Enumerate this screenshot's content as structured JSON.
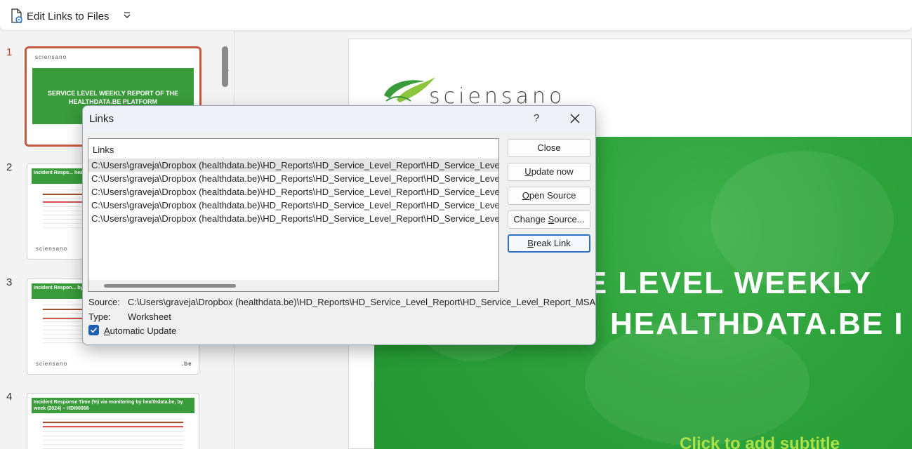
{
  "toolbar": {
    "label": "Edit Links to Files",
    "doc_icon": "linked-document-icon",
    "caret_icon": "chevron-down-icon"
  },
  "slides": [
    {
      "number": "1",
      "title": "SERVICE LEVEL WEEKLY REPORT OF THE HEALTHDATA.BE PLATFORM",
      "logo": "sciensano"
    },
    {
      "number": "2",
      "title": "Incident Respo... healthdata.be, by...",
      "logo": "sciensano"
    },
    {
      "number": "3",
      "title": "Incident Respon... by week (2024) –",
      "logo": "sciensano",
      "footer": ".be"
    },
    {
      "number": "4",
      "title": "Incident Response Time (%) via monitoring by healthdata.be, by week (2024) – HDI00066"
    }
  ],
  "main_slide": {
    "logo_text": "sciensano",
    "title_line1": "CE LEVEL WEEKLY",
    "title_line2": "HEALTHDATA.BE I",
    "subtitle_placeholder": "Click to add subtitle"
  },
  "dialog": {
    "title": "Links",
    "help": "?",
    "close_icon": "close-icon",
    "list_header": "Links",
    "links": [
      "C:\\Users\\graveja\\Dropbox (healthdata.be)\\HD_Reports\\HD_Service_Level_Report\\HD_Service_Level_F",
      "C:\\Users\\graveja\\Dropbox (healthdata.be)\\HD_Reports\\HD_Service_Level_Report\\HD_Service_Level_F",
      "C:\\Users\\graveja\\Dropbox (healthdata.be)\\HD_Reports\\HD_Service_Level_Report\\HD_Service_Level_F",
      "C:\\Users\\graveja\\Dropbox (healthdata.be)\\HD_Reports\\HD_Service_Level_Report\\HD_Service_Level_F",
      "C:\\Users\\graveja\\Dropbox (healthdata.be)\\HD_Reports\\HD_Service_Level_Report\\HD_Service_Level_F"
    ],
    "buttons": {
      "close": "Close",
      "update_now_u": "U",
      "update_now_rest": "pdate now",
      "open_source_u": "O",
      "open_source_rest": "pen Source",
      "change_source_pre": "Change ",
      "change_source_u": "S",
      "change_source_rest": "ource...",
      "break_link_u": "B",
      "break_link_rest": "reak Link"
    },
    "source_label": "Source:",
    "source_value": "C:\\Users\\graveja\\Dropbox (healthdata.be)\\HD_Reports\\HD_Service_Level_Report\\HD_Service_Level_Report_MSA...",
    "type_label": "Type:",
    "type_value": "Worksheet",
    "auto_update_u": "A",
    "auto_update_rest": "utomatic Update",
    "auto_update_checked": true
  }
}
